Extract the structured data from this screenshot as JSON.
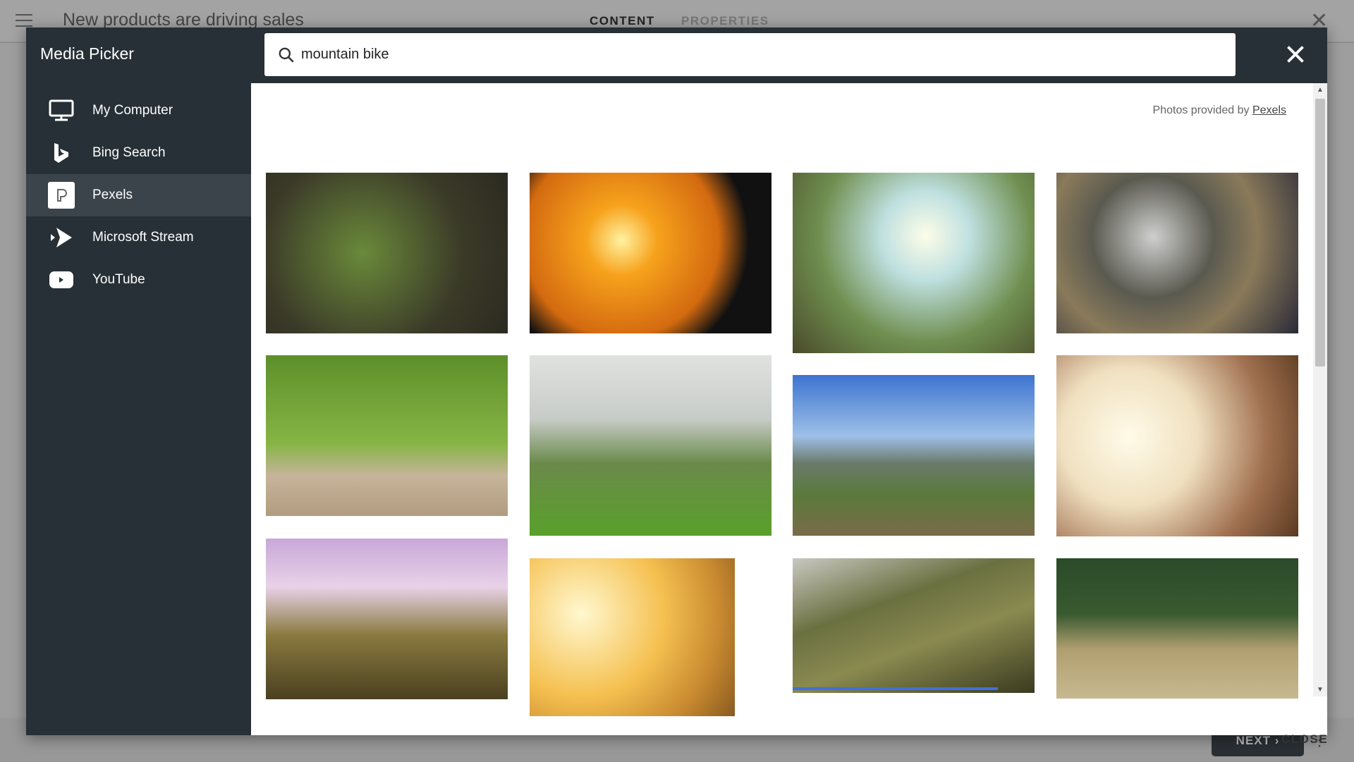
{
  "background": {
    "title": "New products are driving sales",
    "tabs": [
      {
        "label": "CONTENT",
        "active": true
      },
      {
        "label": "PROPERTIES",
        "active": false
      }
    ],
    "next_label": "NEXT"
  },
  "modal": {
    "title": "Media Picker",
    "search": {
      "value": "mountain bike",
      "placeholder": ""
    },
    "sidebar": {
      "items": [
        {
          "label": "My Computer",
          "icon": "monitor-icon"
        },
        {
          "label": "Bing Search",
          "icon": "bing-icon"
        },
        {
          "label": "Pexels",
          "icon": "pexels-icon",
          "selected": true
        },
        {
          "label": "Microsoft Stream",
          "icon": "stream-icon"
        },
        {
          "label": "YouTube",
          "icon": "youtube-icon"
        }
      ]
    },
    "credit": {
      "prefix": "Photos provided by",
      "link": "Pexels"
    },
    "close_label": "CLOSE",
    "accent": "#3f6fe0"
  }
}
